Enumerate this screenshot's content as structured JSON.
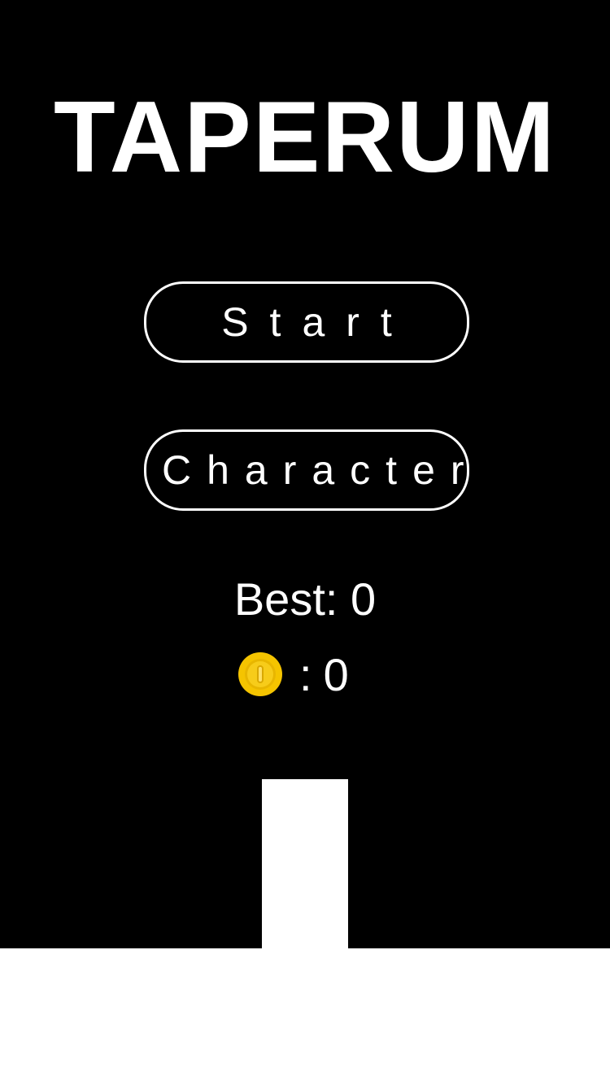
{
  "game": {
    "title": "TAPERUM",
    "menu": {
      "start_label": "Start",
      "character_label": "Character"
    },
    "stats": {
      "best_label": "Best: 0",
      "coin_icon": "coin-icon",
      "coin_separator": ":",
      "coin_count": "0"
    }
  },
  "colors": {
    "background": "#000000",
    "foreground": "#ffffff",
    "coin": "#f5c400"
  }
}
